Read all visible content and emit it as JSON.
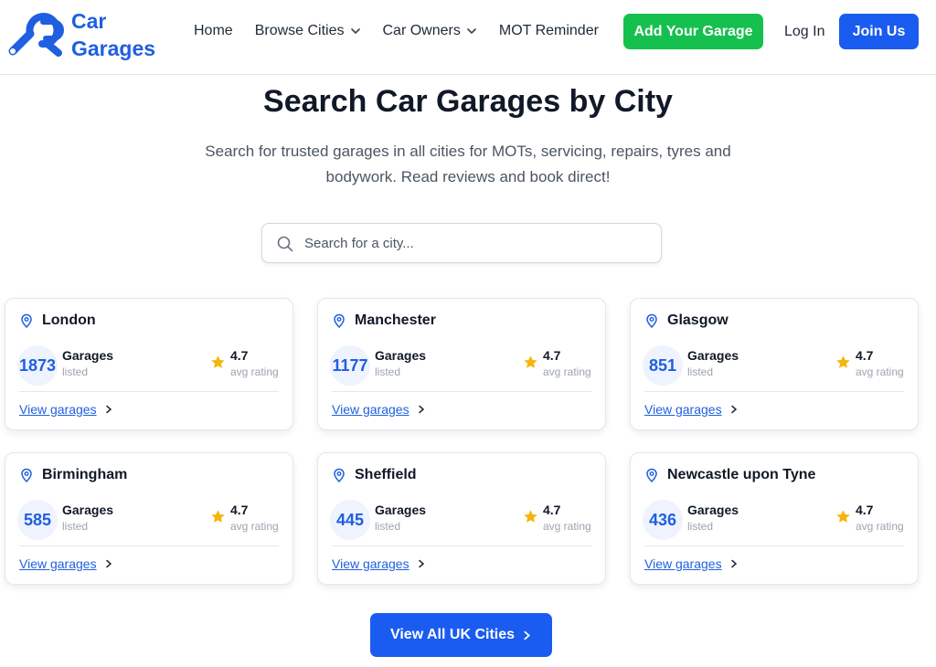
{
  "brand": {
    "line1": "Car",
    "line2": "Garages",
    "color": "#1f5fe0"
  },
  "nav": {
    "home": "Home",
    "browse_cities": "Browse Cities",
    "car_owners": "Car Owners",
    "mot_reminder": "MOT Reminder"
  },
  "header_actions": {
    "add_garage": "Add Your Garage",
    "login": "Log In",
    "join": "Join Us"
  },
  "hero": {
    "title": "Search Car Garages by City",
    "subtitle": "Search for trusted garages in all cities for MOTs, servicing, repairs, tyres and bodywork. Read reviews and book direct!"
  },
  "search": {
    "placeholder": "Search for a city...",
    "value": ""
  },
  "card_labels": {
    "garages": "Garages",
    "listed": "listed",
    "avg_rating": "avg rating",
    "view_garages": "View garages"
  },
  "cities": [
    {
      "name": "London",
      "count": "1873",
      "rating": "4.7"
    },
    {
      "name": "Manchester",
      "count": "1177",
      "rating": "4.7"
    },
    {
      "name": "Glasgow",
      "count": "851",
      "rating": "4.7"
    },
    {
      "name": "Birmingham",
      "count": "585",
      "rating": "4.7"
    },
    {
      "name": "Sheffield",
      "count": "445",
      "rating": "4.7"
    },
    {
      "name": "Newcastle upon Tyne",
      "count": "436",
      "rating": "4.7"
    }
  ],
  "view_all": "View All UK Cities",
  "colors": {
    "primary": "#1a5cf0",
    "success": "#16c04f",
    "star": "#f5b50a"
  }
}
